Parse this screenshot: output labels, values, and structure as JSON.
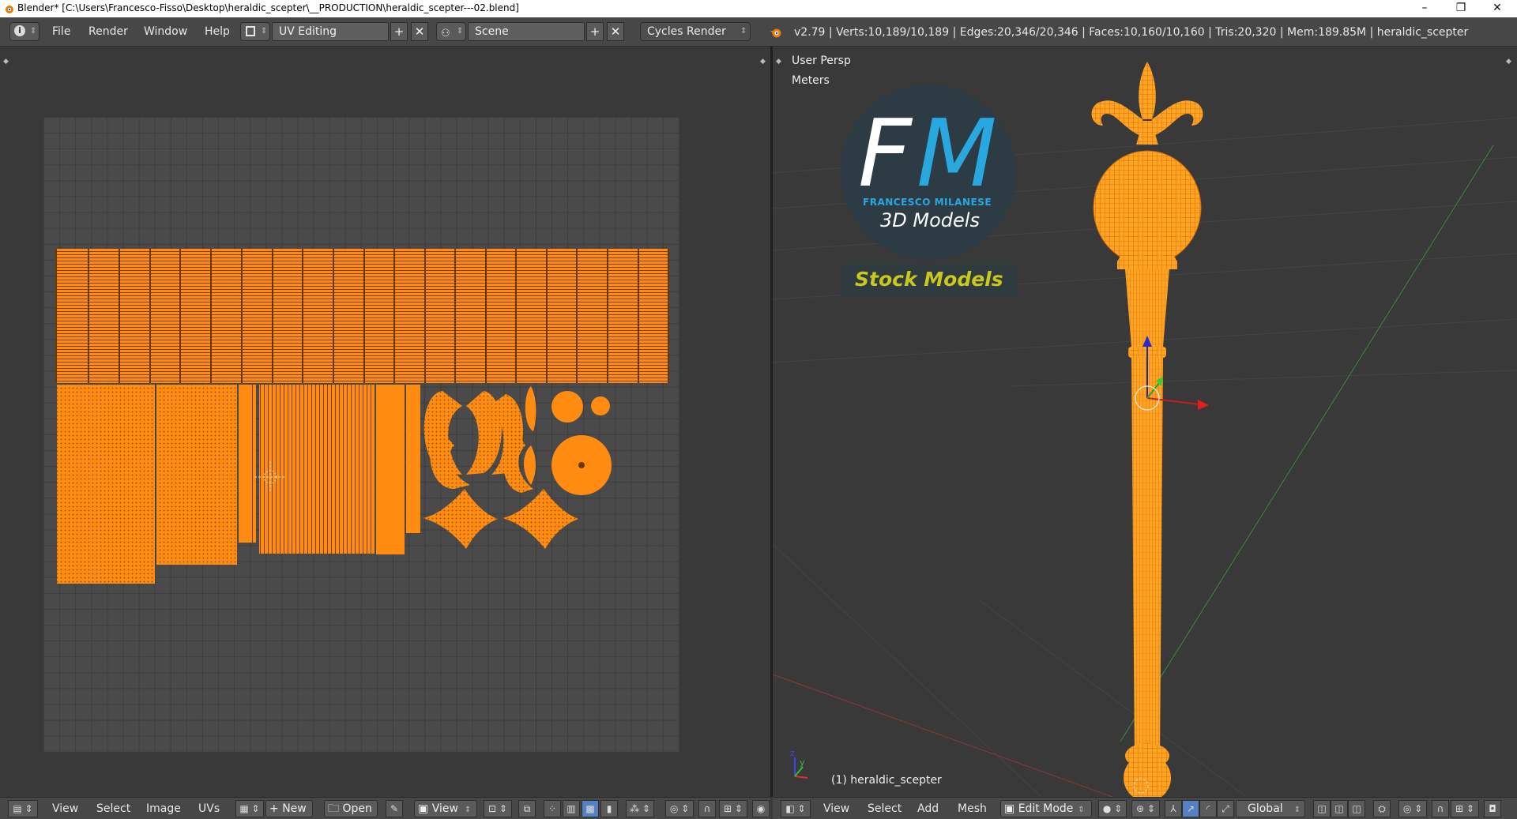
{
  "window": {
    "title": "Blender* [C:\\Users\\Francesco-Fisso\\Desktop\\heraldic_scepter\\__PRODUCTION\\heraldic_scepter---02.blend]",
    "minimize": "–",
    "maximize": "❐",
    "close": "✕"
  },
  "info_header": {
    "menus": [
      "File",
      "Render",
      "Window",
      "Help"
    ],
    "screen_layout": "UV Editing",
    "scene": "Scene",
    "render_engine": "Cycles Render",
    "stats": "v2.79 | Verts:10,189/10,189 | Edges:20,346/20,346 | Faces:10,160/10,160 | Tris:20,320 | Mem:189.85M | heraldic_scepter"
  },
  "viewport": {
    "view_name": "User Persp",
    "units": "Meters",
    "object_label": "(1) heraldic_scepter",
    "watermark": {
      "initials_f": "F",
      "initials_m": "M",
      "author": "FRANCESCO MILANESE",
      "subtitle": "3D Models",
      "banner": "Stock Models"
    }
  },
  "uv_footer": {
    "menus": [
      "View",
      "Select",
      "Image",
      "UVs"
    ],
    "new_label": "New",
    "open_label": "Open",
    "view_label": "View"
  },
  "viewport_footer": {
    "menus": [
      "View",
      "Select",
      "Add",
      "Mesh"
    ],
    "mode": "Edit Mode",
    "orientation": "Global"
  },
  "colors": {
    "uv_orange": "#ff8c10",
    "panel_bg": "#393939",
    "header_bg": "#474747",
    "watermark_blue": "#29a8e0",
    "watermark_yellow": "#c8c81e"
  }
}
